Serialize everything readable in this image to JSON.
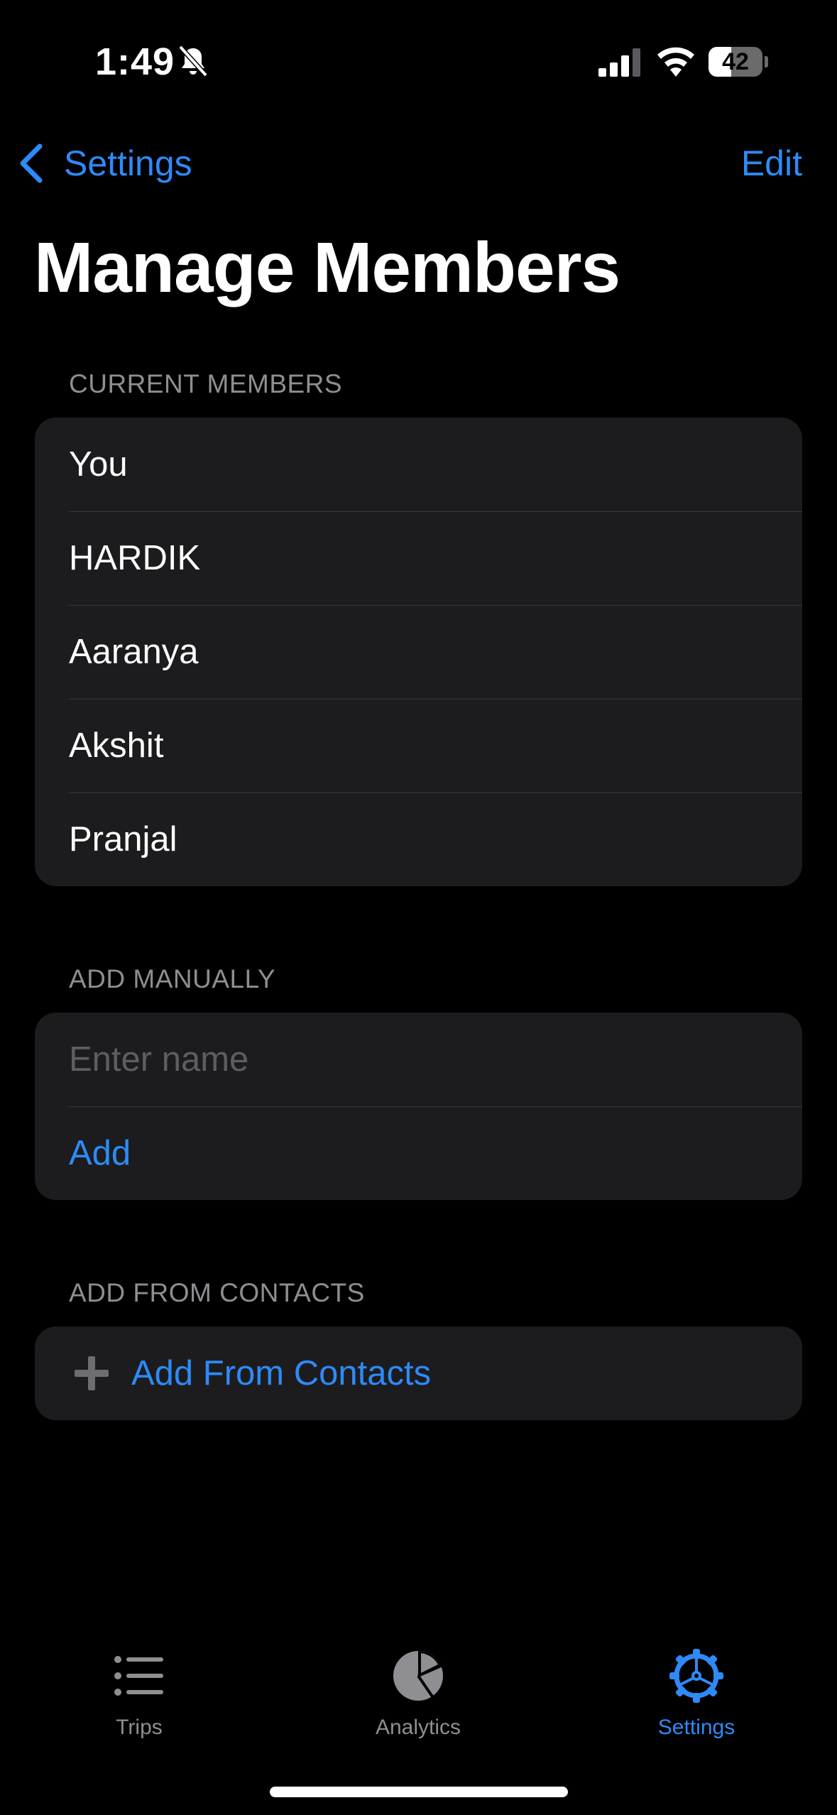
{
  "status_bar": {
    "time": "1:49",
    "battery": "42",
    "battery_level": 0.42,
    "icons": [
      "bell-slash-icon",
      "signal-icon",
      "wifi-icon",
      "battery-icon"
    ]
  },
  "nav": {
    "back_label": "Settings",
    "edit_label": "Edit",
    "title": "Manage Members"
  },
  "sections": {
    "current_members": {
      "header": "CURRENT MEMBERS",
      "members": [
        "You",
        "HARDIK",
        "Aaranya",
        "Akshit",
        "Pranjal"
      ]
    },
    "add_manually": {
      "header": "ADD MANUALLY",
      "input_placeholder": "Enter name",
      "input_value": "",
      "add_label": "Add"
    },
    "add_from_contacts": {
      "header": "ADD FROM CONTACTS",
      "button_label": "Add From Contacts"
    }
  },
  "tab_bar": {
    "tabs": [
      {
        "label": "Trips",
        "icon": "list-icon",
        "active": false
      },
      {
        "label": "Analytics",
        "icon": "pie-chart-icon",
        "active": false
      },
      {
        "label": "Settings",
        "icon": "gear-icon",
        "active": true
      }
    ]
  },
  "colors": {
    "accent": "#2e8af7",
    "background": "#000000",
    "group_background": "#1c1c1e",
    "secondary_text": "#8e8e93"
  }
}
